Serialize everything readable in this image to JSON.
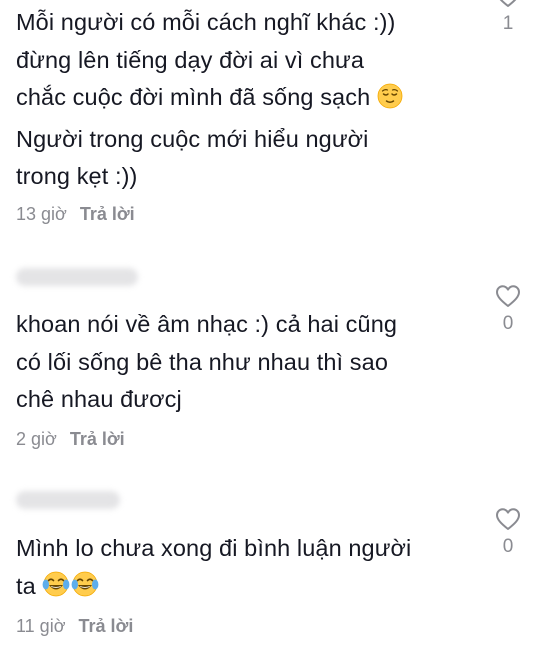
{
  "comments": [
    {
      "text_lines": [
        "Mỗi người có mỗi cách nghĩ khác :))",
        "đừng lên tiếng dạy đời ai vì chưa",
        "chắc cuộc đời mình đã sống sạch",
        "Người trong cuộc mới hiểu người",
        "trong kẹt :))"
      ],
      "time": "13 giờ",
      "reply_label": "Trả lời",
      "like_count": "1",
      "emoji_icon": "relieved-face-icon"
    },
    {
      "text_lines": [
        "khoan nói về âm nhạc :) cả hai cũng",
        "có lối sống bê tha như nhau thì sao",
        "chê nhau đươcj"
      ],
      "time": "2 giờ",
      "reply_label": "Trả lời",
      "like_count": "0"
    },
    {
      "text_lines": [
        "Mình lo chưa xong đi bình luận người",
        "ta"
      ],
      "time": "11 giờ",
      "reply_label": "Trả lời",
      "like_count": "0",
      "emoji_icon": "tears-of-joy-icon"
    }
  ],
  "colors": {
    "text": "#161823",
    "secondary": "#8a8b91",
    "icon": "#8a8b91"
  }
}
